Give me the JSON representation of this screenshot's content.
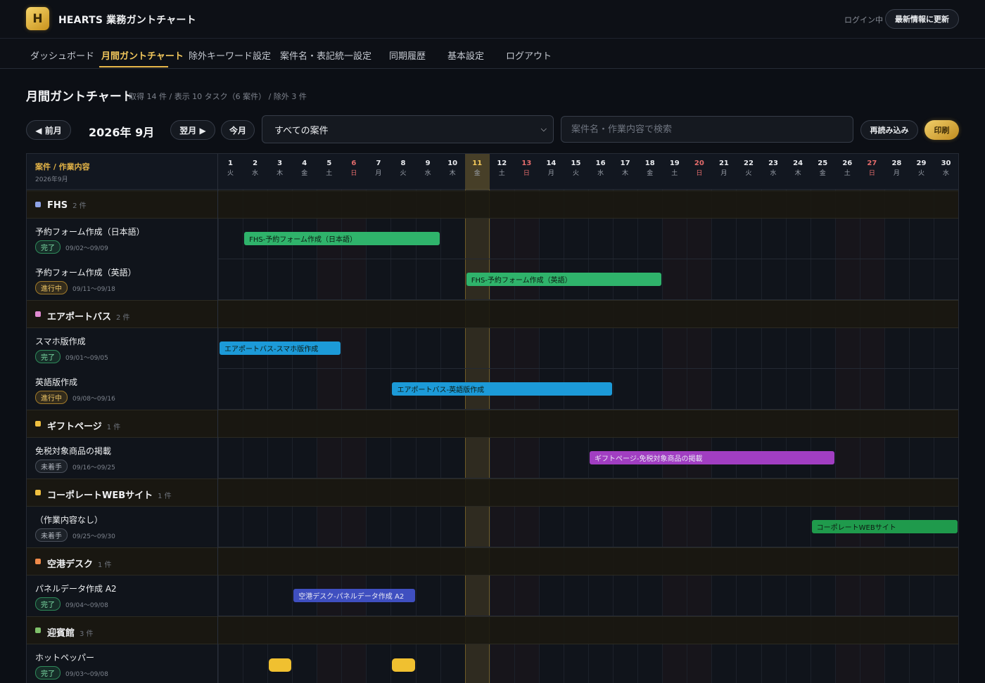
{
  "header": {
    "logo_letter": "H",
    "title": "HEARTS 業務ガントチャート",
    "login_status": "ログイン中",
    "refresh_label": "最新情報に更新"
  },
  "nav": {
    "items": [
      {
        "label": "ダッシュボード"
      },
      {
        "label": "月間ガントチャート",
        "active": true
      },
      {
        "label": "除外キーワード設定"
      },
      {
        "label": "案件名・表記統一設定"
      },
      {
        "label": "同期履歴"
      },
      {
        "label": "基本設定"
      },
      {
        "label": "ログアウト"
      }
    ]
  },
  "page": {
    "title": "月間ガントチャート",
    "summary": "取得 14 件 / 表示 10 タスク（6 案件） / 除外 3 件"
  },
  "toolbar": {
    "prev_label": "◀ 前月",
    "month_label": "2026年 9月",
    "next_label": "翌月 ▶",
    "today_label": "今月",
    "project_filter": "すべての案件",
    "search_placeholder": "案件名・作業内容で検索",
    "reload_label": "再読み込み",
    "print_label": "印刷"
  },
  "gantt": {
    "header_label": "案件 / 作業内容",
    "header_sub": "2026年9月",
    "today_day": 11,
    "days": [
      {
        "d": "1",
        "w": "火"
      },
      {
        "d": "2",
        "w": "水"
      },
      {
        "d": "3",
        "w": "木"
      },
      {
        "d": "4",
        "w": "金"
      },
      {
        "d": "5",
        "w": "土"
      },
      {
        "d": "6",
        "w": "日"
      },
      {
        "d": "7",
        "w": "月"
      },
      {
        "d": "8",
        "w": "火"
      },
      {
        "d": "9",
        "w": "水"
      },
      {
        "d": "10",
        "w": "木"
      },
      {
        "d": "11",
        "w": "金"
      },
      {
        "d": "12",
        "w": "土"
      },
      {
        "d": "13",
        "w": "日"
      },
      {
        "d": "14",
        "w": "月"
      },
      {
        "d": "15",
        "w": "火"
      },
      {
        "d": "16",
        "w": "水"
      },
      {
        "d": "17",
        "w": "木"
      },
      {
        "d": "18",
        "w": "金"
      },
      {
        "d": "19",
        "w": "土"
      },
      {
        "d": "20",
        "w": "日"
      },
      {
        "d": "21",
        "w": "月"
      },
      {
        "d": "22",
        "w": "火"
      },
      {
        "d": "23",
        "w": "水"
      },
      {
        "d": "24",
        "w": "木"
      },
      {
        "d": "25",
        "w": "金"
      },
      {
        "d": "26",
        "w": "土"
      },
      {
        "d": "27",
        "w": "日"
      },
      {
        "d": "28",
        "w": "月"
      },
      {
        "d": "29",
        "w": "火"
      },
      {
        "d": "30",
        "w": "水"
      }
    ],
    "groups": [
      {
        "name": "FHS",
        "count": "2 件",
        "color": "#8fa3e6",
        "tasks": [
          {
            "name": "予約フォーム作成（日本語）",
            "status": "完了",
            "status_type": "done",
            "dates": "09/02〜09/09",
            "start": 2,
            "end": 9,
            "bar_label": "FHS-予約フォーム作成（日本語）",
            "bar_color": "#2fb36b"
          },
          {
            "name": "予約フォーム作成（英語）",
            "status": "進行中",
            "status_type": "prog",
            "dates": "09/11〜09/18",
            "start": 11,
            "end": 18,
            "bar_label": "FHS-予約フォーム作成（英語）",
            "bar_color": "#2fb36b"
          }
        ]
      },
      {
        "name": "エアポートバス",
        "count": "2 件",
        "color": "#e08ad0",
        "tasks": [
          {
            "name": "スマホ版作成",
            "status": "完了",
            "status_type": "done",
            "dates": "09/01〜09/05",
            "start": 1,
            "end": 5,
            "bar_label": "エアポートバス-スマホ版作成",
            "bar_color": "#1c9ad8"
          },
          {
            "name": "英語版作成",
            "status": "進行中",
            "status_type": "prog",
            "dates": "09/08〜09/16",
            "start": 8,
            "end": 16,
            "bar_label": "エアポートバス-英語版作成",
            "bar_color": "#1c9ad8"
          }
        ]
      },
      {
        "name": "ギフトページ",
        "count": "1 件",
        "color": "#f0c040",
        "tasks": [
          {
            "name": "免税対象商品の掲載",
            "status": "未着手",
            "status_type": "todo",
            "dates": "09/16〜09/25",
            "start": 16,
            "end": 25,
            "bar_label": "ギフトページ-免税対象商品の掲載",
            "bar_color": "#a13ec2"
          }
        ]
      },
      {
        "name": "コーポレートWEBサイト",
        "count": "1 件",
        "color": "#f0c040",
        "tasks": [
          {
            "name": "（作業内容なし）",
            "status": "未着手",
            "status_type": "todo",
            "dates": "09/25〜09/30",
            "start": 25,
            "end": 30,
            "bar_label": "コーポレートWEBサイト",
            "bar_color": "#1f9a4c"
          }
        ]
      },
      {
        "name": "空港デスク",
        "count": "1 件",
        "color": "#f08a4a",
        "tasks": [
          {
            "name": "パネルデータ作成 A2",
            "status": "完了",
            "status_type": "done",
            "dates": "09/04〜09/08",
            "start": 4,
            "end": 8,
            "bar_label": "空港デスク-パネルデータ作成 A2",
            "bar_color": "#3f4fc0"
          }
        ]
      },
      {
        "name": "迎賓館",
        "count": "3 件",
        "color": "#7fc06a",
        "tasks": [
          {
            "name": "ホットペッパー",
            "status": "完了",
            "status_type": "done",
            "dates": "09/03〜09/08",
            "markers": [
              3,
              8
            ],
            "marker_color": "#f0c030"
          }
        ]
      }
    ]
  }
}
